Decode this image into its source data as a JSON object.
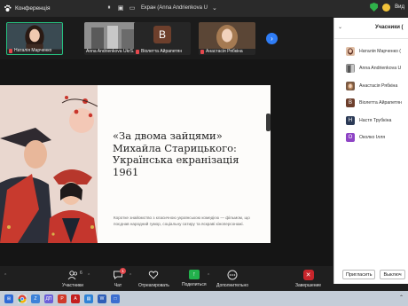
{
  "window": {
    "title": "Конференція",
    "screen_share_title": "Екран (Anna Andrienkova U",
    "view_label": "Вид"
  },
  "gallery": {
    "tiles": [
      {
        "name": "Наталія Марченко",
        "muted": true,
        "active": true
      },
      {
        "name": "Anna Andrienkova UkrS...",
        "muted": false,
        "active": false
      },
      {
        "name": "Віолетта Айрапетян",
        "muted": true,
        "active": false,
        "initial": "B"
      },
      {
        "name": "Анастасія Рябкіна",
        "muted": true,
        "active": false
      }
    ]
  },
  "slide": {
    "title": "«За двома зайцями» Михайла Старицького: Українська екранізація 1961",
    "description": "Коротке знайомство з класичною українською комедією — фільмом, що поєднав народний гумор, соціальну сатиру та яскраві кіноперсонажі."
  },
  "participants": {
    "title": "Учасники (",
    "list": [
      {
        "name": "Наталія Марченко (",
        "initial": "",
        "color": "#c96b4b"
      },
      {
        "name": "Anna Andrienkova U",
        "initial": "",
        "color": "#7a7a7a"
      },
      {
        "name": "Анастасія Рябкіна",
        "initial": "",
        "color": "#b98a6a"
      },
      {
        "name": "Віолетта Айрапетян",
        "initial": "В",
        "color": "#6d3f2c"
      },
      {
        "name": "Настя Трубкіна",
        "initial": "Н",
        "color": "#2b3a56"
      },
      {
        "name": "Околко Ілля",
        "initial": "О",
        "color": "#8e44c5"
      }
    ],
    "invite_label": "Пригласить",
    "mute_label": "Выключ"
  },
  "toolbar": {
    "participants_label": "Участники",
    "participants_count": "6",
    "chat_label": "Чат",
    "chat_badge": "1",
    "react_label": "Отреагировать",
    "share_label": "Поделиться",
    "more_label": "Дополнительно",
    "end_label": "Завершение"
  },
  "colors": {
    "accent_green": "#26c281",
    "end_red": "#c7252b",
    "share_green": "#22b14c"
  }
}
